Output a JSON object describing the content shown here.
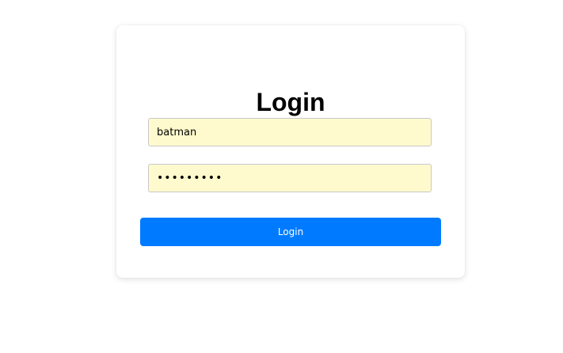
{
  "login_form": {
    "title": "Login",
    "username": {
      "value": "batman",
      "placeholder": ""
    },
    "password": {
      "value": "batmanpwd",
      "placeholder": ""
    },
    "submit_label": "Login"
  },
  "colors": {
    "accent": "#007bff",
    "autofill_background": "#fffacd"
  }
}
